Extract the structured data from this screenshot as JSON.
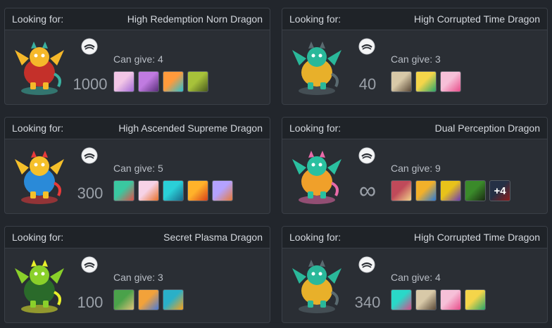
{
  "cards": [
    {
      "looking_label": "Looking for:",
      "dragon": "High Redemption Norn Dragon",
      "amount": "1000",
      "can_give": "Can give: 4",
      "thumbs": [
        {
          "colors": [
            "#f2c6e6",
            "#a46ad6"
          ]
        },
        {
          "colors": [
            "#c07be0",
            "#5a2e7a"
          ]
        },
        {
          "colors": [
            "#ff9a3c",
            "#2bc0d0"
          ]
        },
        {
          "colors": [
            "#a7c23a",
            "#4a5a1e"
          ]
        }
      ]
    },
    {
      "looking_label": "Looking for:",
      "dragon": "High Corrupted Time Dragon",
      "amount": "40",
      "can_give": "Can give: 3",
      "thumbs": [
        {
          "colors": [
            "#d8c9a8",
            "#5c4a38"
          ]
        },
        {
          "colors": [
            "#f4d54a",
            "#2aa56a"
          ]
        },
        {
          "colors": [
            "#f6c0d8",
            "#e84d8a"
          ]
        }
      ]
    },
    {
      "looking_label": "Looking for:",
      "dragon": "High Ascended Supreme Dragon",
      "amount": "300",
      "can_give": "Can give: 5",
      "thumbs": [
        {
          "colors": [
            "#3ac8a0",
            "#e0504a"
          ]
        },
        {
          "colors": [
            "#f6d2e6",
            "#e8702a"
          ]
        },
        {
          "colors": [
            "#2ad0d8",
            "#1a6a8a"
          ]
        },
        {
          "colors": [
            "#ffb22a",
            "#d8401a"
          ]
        },
        {
          "colors": [
            "#b4a2ff",
            "#e87a3a"
          ]
        }
      ]
    },
    {
      "looking_label": "Looking for:",
      "dragon": "Dual Perception Dragon",
      "amount": "∞",
      "can_give": "Can give: 9",
      "thumbs": [
        {
          "colors": [
            "#c04a5a",
            "#f2d48a"
          ]
        },
        {
          "colors": [
            "#f2b02a",
            "#2a7ad8"
          ]
        },
        {
          "colors": [
            "#e8c21a",
            "#6a3ab8"
          ]
        },
        {
          "colors": [
            "#3a8a2a",
            "#1a2a12"
          ]
        },
        {
          "colors": [
            "#3a4a6a",
            "#d82a2a"
          ],
          "more": "+4"
        }
      ]
    },
    {
      "looking_label": "Looking for:",
      "dragon": "Secret Plasma Dragon",
      "amount": "100",
      "can_give": "Can give: 3",
      "thumbs": [
        {
          "colors": [
            "#4aa24a",
            "#e0c27a"
          ]
        },
        {
          "colors": [
            "#f2a23a",
            "#4a7ad8"
          ]
        },
        {
          "colors": [
            "#2ab0c8",
            "#f8a21a"
          ]
        }
      ]
    },
    {
      "looking_label": "Looking for:",
      "dragon": "High Corrupted Time Dragon",
      "amount": "340",
      "can_give": "Can give: 4",
      "thumbs": [
        {
          "colors": [
            "#2ad8c8",
            "#d84a8a"
          ]
        },
        {
          "colors": [
            "#d8c9a8",
            "#5c4a38"
          ]
        },
        {
          "colors": [
            "#f6c0d8",
            "#e84d8a"
          ]
        },
        {
          "colors": [
            "#f4d54a",
            "#2aa56a"
          ]
        }
      ]
    }
  ],
  "dragon_art": [
    {
      "colors": [
        "#f5b82a",
        "#c4302a",
        "#3ab0a0"
      ]
    },
    {
      "colors": [
        "#2ab89a",
        "#e8b02a",
        "#5a6a70"
      ]
    },
    {
      "colors": [
        "#f5c02a",
        "#2a8ad8",
        "#e83a3a"
      ]
    },
    {
      "colors": [
        "#2ac0a0",
        "#f0a02a",
        "#e86aa8"
      ]
    },
    {
      "colors": [
        "#8ad02a",
        "#2a6a2a",
        "#e8f02a"
      ]
    },
    {
      "colors": [
        "#2ab89a",
        "#e8b02a",
        "#5a6a70"
      ]
    }
  ]
}
